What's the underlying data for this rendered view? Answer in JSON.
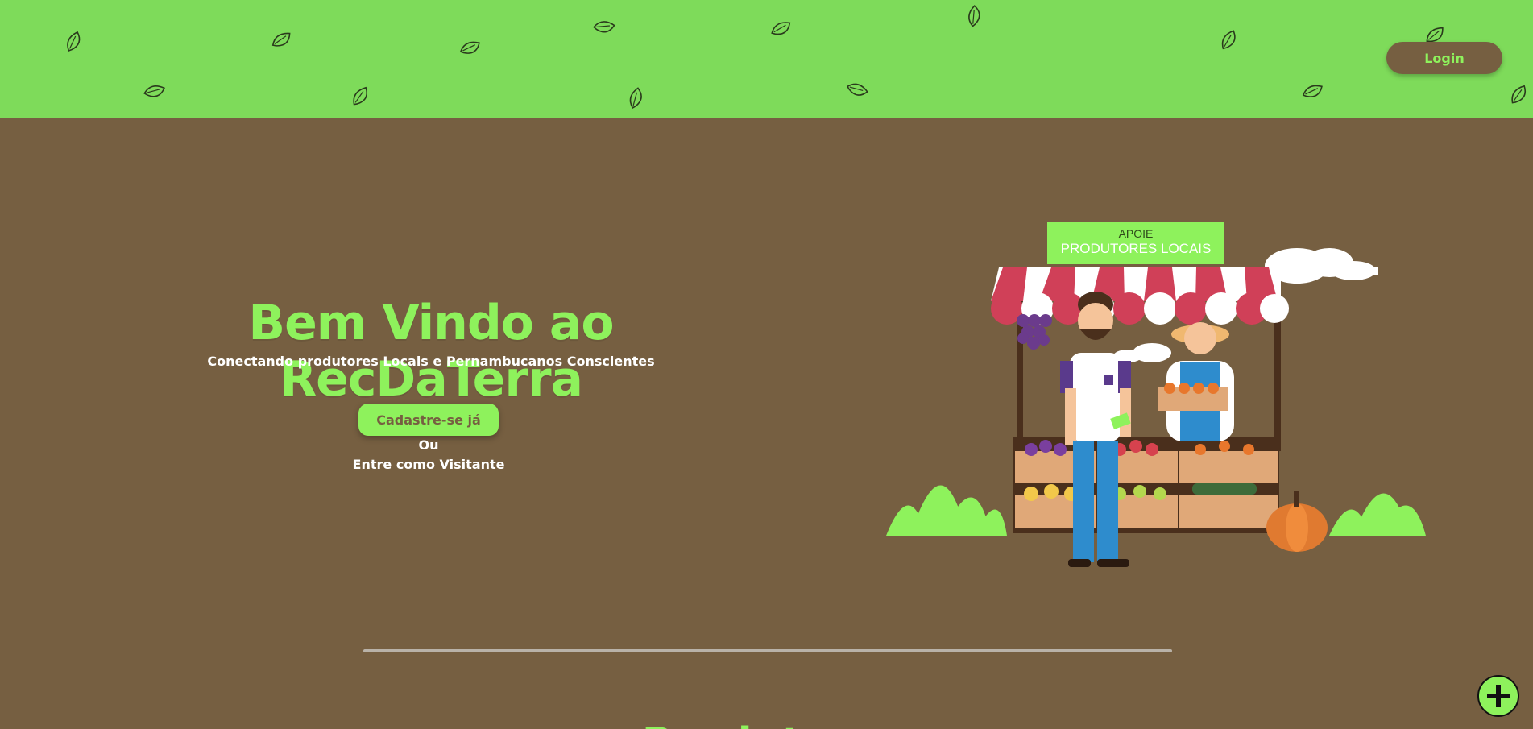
{
  "header": {
    "login_label": "Login",
    "bg_color": "#7edb5a"
  },
  "hero": {
    "title": "Bem Vindo ao RecDaTerra",
    "subtitle": "Conectando produtores Locais e Pernambucanos Conscientes",
    "cta_label": "Cadastre-se já",
    "or_label": "Ou",
    "visitor_label": "Entre como Visitante"
  },
  "illustration": {
    "sign_line1": "APOIE",
    "sign_line2": "PRODUTORES LOCAIS"
  },
  "next_section": {
    "heading_partial": "Produtores Conscientes"
  },
  "fab": {
    "icon": "plus-icon"
  },
  "colors": {
    "brand_green": "#8ef25c",
    "header_green": "#7edb5a",
    "earth_brown": "#765f41"
  }
}
